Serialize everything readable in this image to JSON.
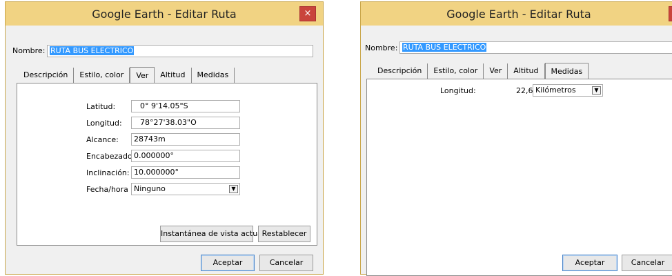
{
  "left_dialog": {
    "title": "Google Earth - Editar Ruta",
    "close_glyph": "×",
    "name_label": "Nombre:",
    "name_value": "RUTA BUS ELECTRICO",
    "tabs": [
      "Descripción",
      "Estilo, color",
      "Ver",
      "Altitud",
      "Medidas"
    ],
    "active_tab": "Ver",
    "fields": [
      {
        "label": "Latitud:",
        "value": "0° 9'14.05\"S"
      },
      {
        "label": "Longitud:",
        "value": "78°27'38.03\"O"
      },
      {
        "label": "Alcance:",
        "value": "28743m"
      },
      {
        "label": "Encabezado:",
        "value": "0.000000°"
      },
      {
        "label": "Inclinación:",
        "value": "10.000000°"
      }
    ],
    "fecha_label": "Fecha/hora",
    "fecha_value": "Ninguno",
    "snapshot_button": "Instantánea de vista actual",
    "reset_button": "Restablecer",
    "ok_button": "Aceptar",
    "cancel_button": "Cancelar"
  },
  "right_dialog": {
    "title": "Google Earth - Editar Ruta",
    "close_glyph": "×",
    "name_label": "Nombre:",
    "name_value": "RUTA BUS ELECTRICO",
    "tabs": [
      "Descripción",
      "Estilo, color",
      "Ver",
      "Altitud",
      "Medidas"
    ],
    "active_tab": "Medidas",
    "length_label": "Longitud:",
    "length_value": "22,6",
    "unit_value": "Kilómetros",
    "ok_button": "Aceptar",
    "cancel_button": "Cancelar"
  },
  "colors": {
    "titlebar": "#f1d383",
    "close": "#c9443c",
    "selection": "#3399ff"
  },
  "icons": [
    "close-icon",
    "dropdown-arrow-icon"
  ]
}
